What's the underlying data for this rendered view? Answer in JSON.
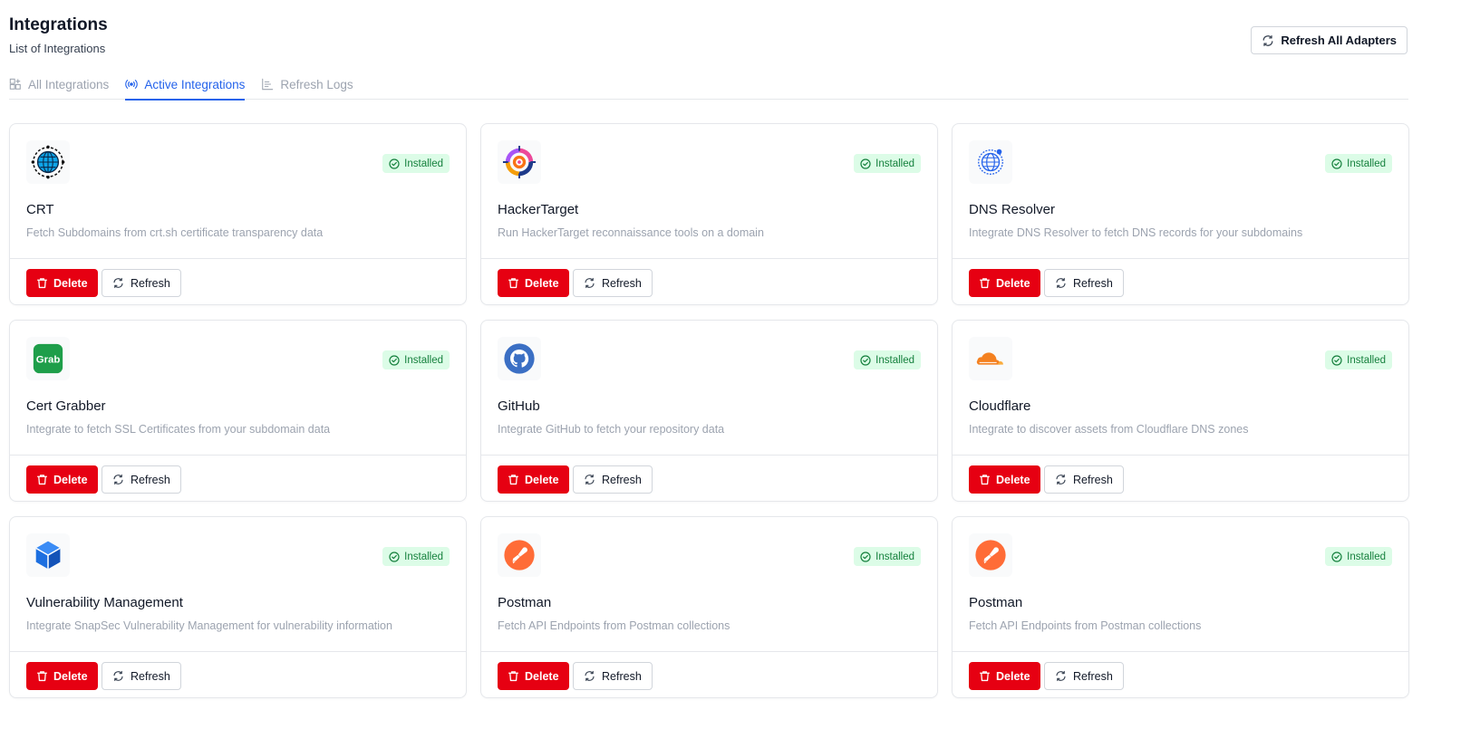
{
  "header": {
    "title": "Integrations",
    "subtitle": "List of Integrations"
  },
  "toolbar": {
    "refresh_all_label": "Refresh All Adapters"
  },
  "tabs": [
    {
      "label": "All Integrations",
      "icon": "grid-plus-icon",
      "active": false
    },
    {
      "label": "Active Integrations",
      "icon": "broadcast-icon",
      "active": true
    },
    {
      "label": "Refresh Logs",
      "icon": "chart-bars-icon",
      "active": false
    }
  ],
  "colors": {
    "accent": "#2563eb",
    "danger": "#e60012",
    "success_bg": "#dcfce7",
    "success_text": "#15803d"
  },
  "cards": [
    {
      "name": "CRT",
      "desc": "Fetch Subdomains from crt.sh certificate transparency data",
      "status": "Installed",
      "icon": "globe-icon",
      "delete_label": "Delete",
      "refresh_label": "Refresh"
    },
    {
      "name": "HackerTarget",
      "desc": "Run HackerTarget reconnaissance tools on a domain",
      "status": "Installed",
      "icon": "target-icon",
      "delete_label": "Delete",
      "refresh_label": "Refresh"
    },
    {
      "name": "DNS Resolver",
      "desc": "Integrate DNS Resolver to fetch DNS records for your subdomains",
      "status": "Installed",
      "icon": "dns-globe-icon",
      "delete_label": "Delete",
      "refresh_label": "Refresh"
    },
    {
      "name": "Cert Grabber",
      "desc": "Integrate to fetch SSL Certificates from your subdomain data",
      "status": "Installed",
      "icon": "grab-logo-icon",
      "logo_text": "Grab",
      "delete_label": "Delete",
      "refresh_label": "Refresh"
    },
    {
      "name": "GitHub",
      "desc": "Integrate GitHub to fetch your repository data",
      "status": "Installed",
      "icon": "github-icon",
      "delete_label": "Delete",
      "refresh_label": "Refresh"
    },
    {
      "name": "Cloudflare",
      "desc": "Integrate to discover assets from Cloudflare DNS zones",
      "status": "Installed",
      "icon": "cloudflare-icon",
      "delete_label": "Delete",
      "refresh_label": "Refresh"
    },
    {
      "name": "Vulnerability Management",
      "desc": "Integrate SnapSec Vulnerability Management for vulnerability information",
      "status": "Installed",
      "icon": "cube-icon",
      "delete_label": "Delete",
      "refresh_label": "Refresh"
    },
    {
      "name": "Postman",
      "desc": "Fetch API Endpoints from Postman collections",
      "status": "Installed",
      "icon": "postman-icon",
      "delete_label": "Delete",
      "refresh_label": "Refresh"
    },
    {
      "name": "Postman",
      "desc": "Fetch API Endpoints from Postman collections",
      "status": "Installed",
      "icon": "postman-icon",
      "delete_label": "Delete",
      "refresh_label": "Refresh"
    }
  ]
}
